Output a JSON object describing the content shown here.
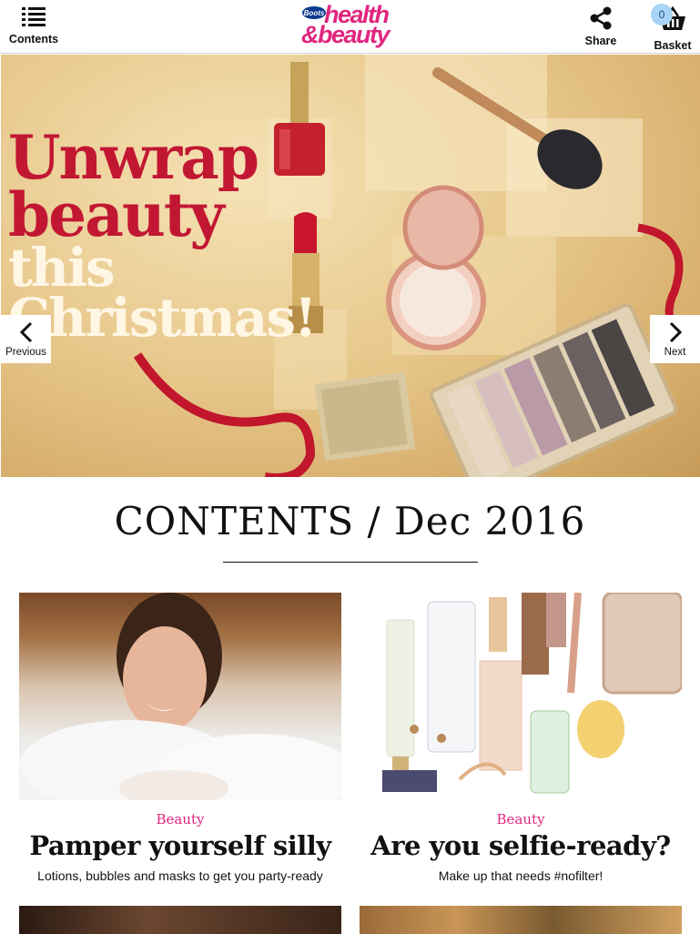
{
  "header": {
    "contents_label": "Contents",
    "logo_small": "Boots",
    "logo_line1": "health",
    "logo_line2": "&beauty",
    "share_label": "Share",
    "basket_label": "Basket",
    "basket_count": "0",
    "icons": [
      "list-icon",
      "share-icon",
      "basket-icon"
    ]
  },
  "hero": {
    "line1": "Unwrap",
    "line2": "beauty",
    "line3": "this",
    "line4": "Christmas!",
    "prev_label": "Previous",
    "next_label": "Next"
  },
  "contents": {
    "title": "CONTENTS / Dec 2016"
  },
  "cards": [
    {
      "category": "Beauty",
      "title": "Pamper yourself silly",
      "subtitle": "Lotions, bubbles and masks to get you party-ready"
    },
    {
      "category": "Beauty",
      "title": "Are you selfie-ready?",
      "subtitle": "Make up that needs #nofilter!"
    }
  ],
  "colors": {
    "brand_pink": "#e0267f",
    "hero_red": "#c21733",
    "badge_blue": "#a9d4f5"
  }
}
